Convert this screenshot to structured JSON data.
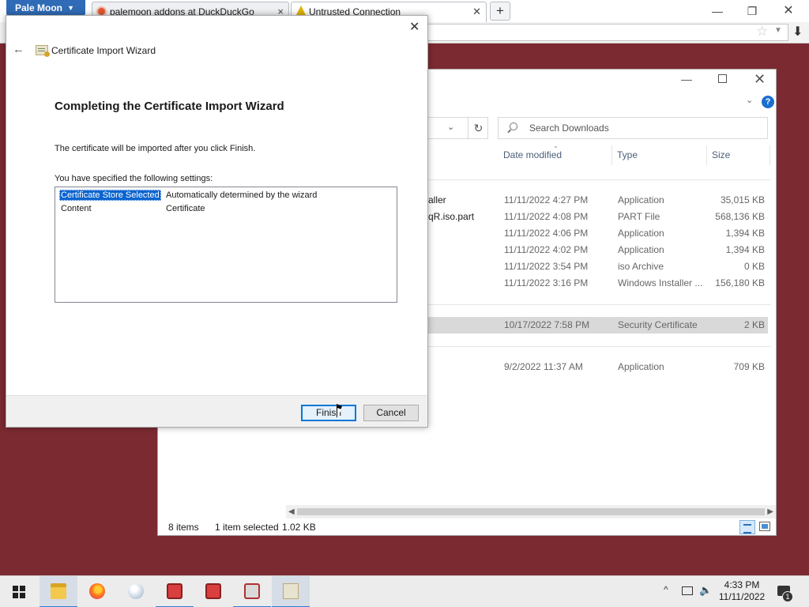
{
  "browser": {
    "app_menu_label": "Pale Moon",
    "tabs": [
      {
        "title": "palemoon addons at DuckDuckGo",
        "close": "×"
      },
      {
        "title": "Untrusted Connection",
        "close": "✕"
      }
    ],
    "new_tab": "+"
  },
  "explorer": {
    "search_placeholder": "Search Downloads",
    "columns": [
      "Date modified",
      "Type",
      "Size"
    ],
    "rows": [
      {
        "name": "aller",
        "date": "11/11/2022 4:27 PM",
        "type": "Application",
        "size": "35,015 KB"
      },
      {
        "name": "qR.iso.part",
        "date": "11/11/2022 4:08 PM",
        "type": "PART File",
        "size": "568,136 KB"
      },
      {
        "name": "",
        "date": "11/11/2022 4:06 PM",
        "type": "Application",
        "size": "1,394 KB"
      },
      {
        "name": "",
        "date": "11/11/2022 4:02 PM",
        "type": "Application",
        "size": "1,394 KB"
      },
      {
        "name": "",
        "date": "11/11/2022 3:54 PM",
        "type": "iso Archive",
        "size": "0 KB"
      },
      {
        "name": "",
        "date": "11/11/2022 3:16 PM",
        "type": "Windows Installer ...",
        "size": "156,180 KB"
      },
      {
        "name": "",
        "date": "10/17/2022 7:58 PM",
        "type": "Security Certificate",
        "size": "2 KB"
      },
      {
        "name": "",
        "date": "9/2/2022 11:37 AM",
        "type": "Application",
        "size": "709 KB"
      }
    ],
    "status": {
      "items": "8 items",
      "selected": "1 item selected",
      "size": "1.02 KB"
    }
  },
  "wizard": {
    "title": "Certificate Import Wizard",
    "heading": "Completing the Certificate Import Wizard",
    "description": "The certificate will be imported after you click Finish.",
    "settings_label": "You have specified the following settings:",
    "settings": [
      {
        "key": "Certificate Store Selected",
        "value": "Automatically determined by the wizard"
      },
      {
        "key": "Content",
        "value": "Certificate"
      }
    ],
    "finish_label": "Finish",
    "cancel_label": "Cancel"
  },
  "taskbar": {
    "apps": [
      "folder-icon",
      "firefox-icon",
      "palemoon-icon",
      "toolbox-icon",
      "toolbox-icon",
      "toolbox-error-icon",
      "certificate-wizard-icon"
    ],
    "time": "4:33 PM",
    "date": "11/11/2022",
    "notification_count": "1"
  },
  "colors": {
    "desktop": "#7b2a31",
    "selection": "#0a64cf",
    "accent": "#0078d7"
  }
}
